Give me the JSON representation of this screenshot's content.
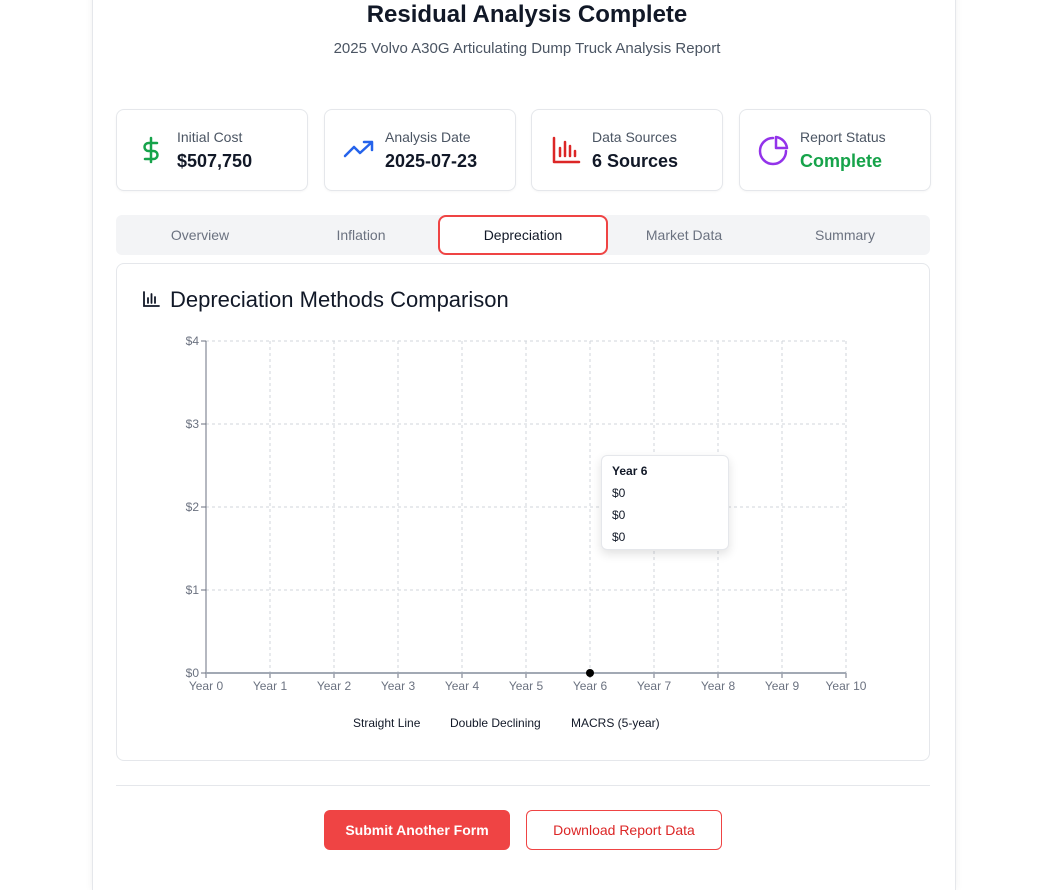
{
  "header": {
    "title": "Residual Analysis Complete",
    "subtitle": "2025 Volvo A30G Articulating Dump Truck Analysis Report"
  },
  "stats": [
    {
      "label": "Initial Cost",
      "value": "$507,750",
      "icon": "dollar-icon",
      "color": "#16a34a"
    },
    {
      "label": "Analysis Date",
      "value": "2025-07-23",
      "icon": "trending-up-icon",
      "color": "#2563eb"
    },
    {
      "label": "Data Sources",
      "value": "6 Sources",
      "icon": "bar-chart-icon",
      "color": "#dc2626"
    },
    {
      "label": "Report Status",
      "value": "Complete",
      "icon": "pie-chart-icon",
      "color": "#9333ea",
      "value_color": "#16a34a"
    }
  ],
  "tabs": [
    {
      "label": "Overview"
    },
    {
      "label": "Inflation"
    },
    {
      "label": "Depreciation",
      "active": true
    },
    {
      "label": "Market Data"
    },
    {
      "label": "Summary"
    }
  ],
  "panel": {
    "title": "Depreciation Methods Comparison",
    "icon": "bar-chart-icon"
  },
  "chart_data": {
    "type": "line",
    "title": "Depreciation Methods Comparison",
    "categories": [
      "Year 0",
      "Year 1",
      "Year 2",
      "Year 3",
      "Year 4",
      "Year 5",
      "Year 6",
      "Year 7",
      "Year 8",
      "Year 9",
      "Year 10"
    ],
    "y_ticks": [
      "$0",
      "$1",
      "$2",
      "$3",
      "$4"
    ],
    "ylim": [
      0,
      4
    ],
    "grid": true,
    "legend_position": "bottom",
    "series": [
      {
        "name": "Straight Line",
        "values": [
          0,
          0,
          0,
          0,
          0,
          0,
          0,
          0,
          0,
          0,
          0
        ]
      },
      {
        "name": "Double Declining",
        "values": [
          0,
          0,
          0,
          0,
          0,
          0,
          0,
          0,
          0,
          0,
          0
        ]
      },
      {
        "name": "MACRS (5-year)",
        "values": [
          0,
          0,
          0,
          0,
          0,
          0,
          0,
          0,
          0,
          0,
          0
        ]
      }
    ],
    "tooltip": {
      "title": "Year 6",
      "values": [
        "$0",
        "$0",
        "$0"
      ]
    },
    "highlight_index": 6
  },
  "actions": {
    "submit_label": "Submit Another Form",
    "download_label": "Download Report Data"
  }
}
